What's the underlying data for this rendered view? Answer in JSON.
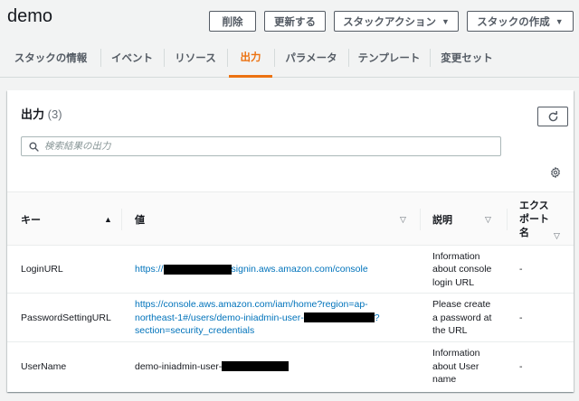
{
  "stack": {
    "name": "demo"
  },
  "actions": {
    "delete": "削除",
    "update": "更新する",
    "stack_actions": "スタックアクション",
    "create_stack": "スタックの作成"
  },
  "tabs": [
    {
      "label": "スタックの情報",
      "active": false
    },
    {
      "label": "イベント",
      "active": false
    },
    {
      "label": "リソース",
      "active": false
    },
    {
      "label": "出力",
      "active": true
    },
    {
      "label": "パラメータ",
      "active": false
    },
    {
      "label": "テンプレート",
      "active": false
    },
    {
      "label": "変更セット",
      "active": false
    }
  ],
  "outputs": {
    "title": "出力",
    "count": "(3)",
    "search_placeholder": "検索結果の出力",
    "columns": {
      "key": "キー",
      "value": "値",
      "description": "説明",
      "export_name": "エクスポート名",
      "export_name_lines": [
        "エクス",
        "ポート",
        "名"
      ]
    },
    "rows": [
      {
        "key": "LoginURL",
        "value_prefix": "https://",
        "value_suffix": "signin.aws.amazon.com/console",
        "description": [
          "Information",
          "about console",
          "login URL"
        ],
        "export": "-"
      },
      {
        "key": "PasswordSettingURL",
        "value_line1": "https://console.aws.amazon.com/iam/home?region=ap-",
        "value_line2_prefix": "northeast-1#/users/demo-iniadmin-user-",
        "value_line2_suffix": "?",
        "value_line3": "section=security_credentials",
        "description": [
          "Please create",
          "a password at",
          "the URL"
        ],
        "export": "-"
      },
      {
        "key": "UserName",
        "value_prefix": "demo-iniadmin-user-",
        "description": [
          "Information",
          "about User",
          "name"
        ],
        "export": "-"
      }
    ]
  },
  "colors": {
    "accent": "#ec7211",
    "link": "#0073bb",
    "text": "#16191f",
    "muted": "#545b64"
  },
  "icons": [
    "search-icon",
    "refresh-icon",
    "gear-icon",
    "sort-ascending-icon",
    "sort-icon",
    "caret-down-icon"
  ]
}
